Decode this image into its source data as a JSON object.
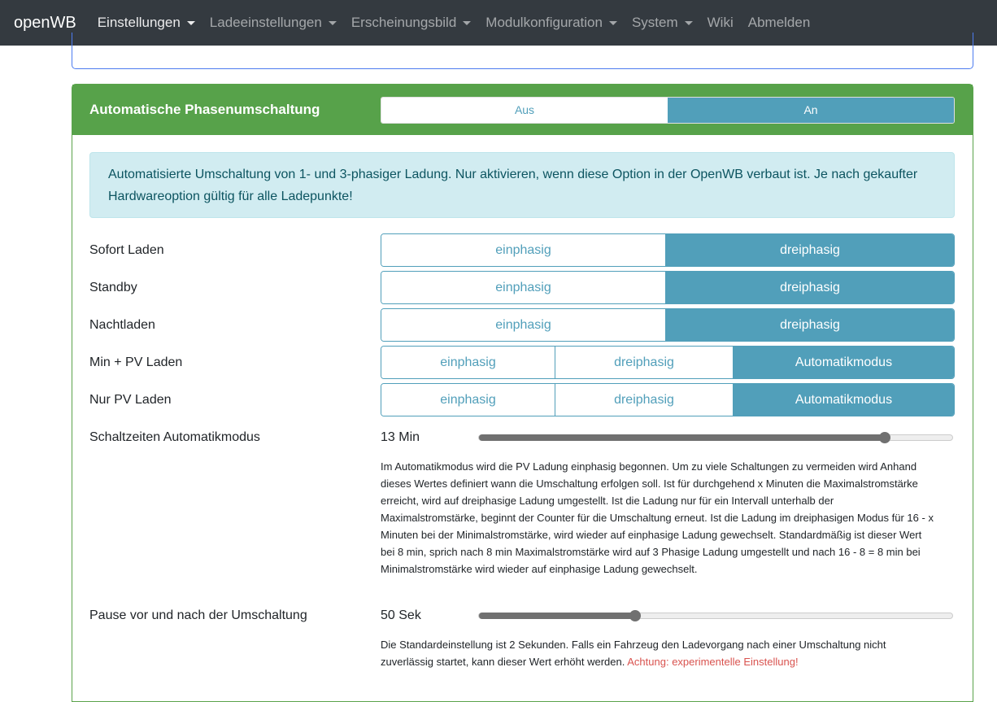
{
  "nav": {
    "brand": "openWB",
    "items": [
      "Einstellungen",
      "Ladeeinstellungen",
      "Erscheinungsbild",
      "Modulkonfiguration",
      "System",
      "Wiki",
      "Abmelden"
    ]
  },
  "card": {
    "title": "Automatische Phasenumschaltung",
    "toggle": {
      "off": "Aus",
      "on": "An",
      "selected": "An"
    },
    "info": "Automatisierte Umschaltung von 1- und 3-phasiger Ladung. Nur aktivieren, wenn diese Option in der OpenWB verbaut ist. Je nach gekaufter Hardwareoption gültig für alle Ladepunkte!",
    "rows": [
      {
        "label": "Sofort Laden",
        "options": [
          "einphasig",
          "dreiphasig"
        ],
        "selected": "dreiphasig"
      },
      {
        "label": "Standby",
        "options": [
          "einphasig",
          "dreiphasig"
        ],
        "selected": "dreiphasig"
      },
      {
        "label": "Nachtladen",
        "options": [
          "einphasig",
          "dreiphasig"
        ],
        "selected": "dreiphasig"
      },
      {
        "label": "Min + PV Laden",
        "options": [
          "einphasig",
          "dreiphasig",
          "Automatikmodus"
        ],
        "selected": "Automatikmodus"
      },
      {
        "label": "Nur PV Laden",
        "options": [
          "einphasig",
          "dreiphasig",
          "Automatikmodus"
        ],
        "selected": "Automatikmodus"
      }
    ],
    "switch_time": {
      "label": "Schaltzeiten Automatikmodus",
      "value": "13 Min",
      "fraction": 0.857,
      "help": "Im Automatikmodus wird die PV Ladung einphasig begonnen. Um zu viele Schaltungen zu vermeiden wird Anhand dieses Wertes definiert wann die Umschaltung erfolgen soll. Ist für durchgehend x Minuten die Maximalstromstärke erreicht, wird auf dreiphasige Ladung umgestellt. Ist die Ladung nur für ein Intervall unterhalb der Maximalstromstärke, beginnt der Counter für die Umschaltung erneut. Ist die Ladung im dreiphasigen Modus für 16 - x Minuten bei der Minimalstromstärke, wird wieder auf einphasige Ladung gewechselt. Standardmäßig ist dieser Wert bei 8 min, sprich nach 8 min Maximalstromstärke wird auf 3 Phasige Ladung umgestellt und nach 16 - 8 = 8 min bei Minimalstromstärke wird wieder auf einphasige Ladung gewechselt."
    },
    "pause": {
      "label": "Pause vor und nach der Umschaltung",
      "value": "50 Sek",
      "fraction": 0.33,
      "help": "Die Standardeinstellung ist 2 Sekunden. Falls ein Fahrzeug den Ladevorgang nach einer Umschaltung nicht zuverlässig startet, kann dieser Wert erhöht werden.",
      "warning": "Achtung: experimentelle Einstellung!"
    }
  }
}
